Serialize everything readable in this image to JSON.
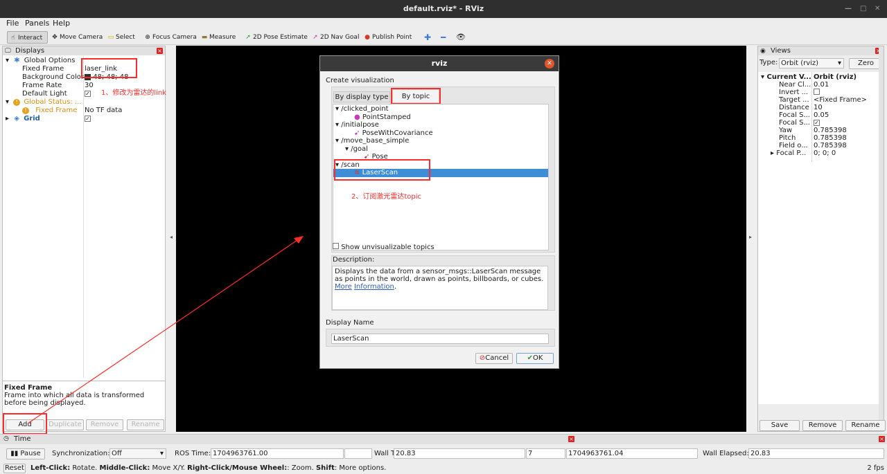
{
  "window": {
    "title": "default.rviz* - RViz"
  },
  "menu": [
    "File",
    "Panels",
    "Help"
  ],
  "toolbar": {
    "interact": "Interact",
    "move_camera": "Move Camera",
    "select": "Select",
    "focus_camera": "Focus Camera",
    "measure": "Measure",
    "pose_estimate": "2D Pose Estimate",
    "nav_goal": "2D Nav Goal",
    "publish_point": "Publish Point"
  },
  "displays": {
    "title": "Displays",
    "global_options": "Global Options",
    "fixed_frame_label": "Fixed Frame",
    "fixed_frame_value": "laser_link",
    "bg_color_label": "Background Color",
    "bg_color_value": "48; 48; 48",
    "frame_rate_label": "Frame Rate",
    "frame_rate_value": "30",
    "default_light_label": "Default Light",
    "global_status": "Global Status: ...",
    "fixed_frame_status": "Fixed Frame",
    "fixed_frame_status_value": "No TF data",
    "grid": "Grid",
    "desc_title": "Fixed Frame",
    "desc_body": "Frame into which all data is transformed before being displayed.",
    "buttons": {
      "add": "Add",
      "duplicate": "Duplicate",
      "remove": "Remove",
      "rename": "Rename"
    }
  },
  "annotations": {
    "step1": "1、修改为雷达的link",
    "step2": "2、订阅激光雷达topic"
  },
  "dialog": {
    "title": "rviz",
    "heading": "Create visualization",
    "tab_display_type": "By display type",
    "tab_topic": "By topic",
    "topics": [
      {
        "name": "/clicked_point",
        "type": "PointStamped"
      },
      {
        "name": "/initialpose",
        "type": "PoseWithCovariance"
      },
      {
        "name": "/move_base_simple",
        "sub": "/goal",
        "type": "Pose"
      },
      {
        "name": "/scan",
        "type": "LaserScan"
      }
    ],
    "show_unvisualizable": "Show unvisualizable topics",
    "description_label": "Description:",
    "description_text": "Displays the data from a sensor_msgs::LaserScan message as points in the world, drawn as points, billboards, or cubes.",
    "more_info_1": "More",
    "more_info_2": "Information",
    "display_name_label": "Display Name",
    "display_name_value": "LaserScan",
    "cancel": "Cancel",
    "ok": "OK"
  },
  "views": {
    "title": "Views",
    "type_label": "Type:",
    "type_value": "Orbit (rviz)",
    "zero": "Zero",
    "current_view": "Current V...",
    "current_view_value": "Orbit (rviz)",
    "props": [
      {
        "k": "Near Cl...",
        "v": "0.01"
      },
      {
        "k": "Invert ...",
        "v": ""
      },
      {
        "k": "Target ...",
        "v": "<Fixed Frame>"
      },
      {
        "k": "Distance",
        "v": "10"
      },
      {
        "k": "Focal S...",
        "v": "0.05"
      },
      {
        "k": "Focal S...",
        "v": ""
      },
      {
        "k": "Yaw",
        "v": "0.785398"
      },
      {
        "k": "Pitch",
        "v": "0.785398"
      },
      {
        "k": "Field o...",
        "v": "0.785398"
      },
      {
        "k": "Focal P...",
        "v": "0; 0; 0"
      }
    ],
    "save": "Save",
    "remove": "Remove",
    "rename": "Rename"
  },
  "time": {
    "title": "Time",
    "pause": "Pause",
    "sync_label": "Synchronization:",
    "sync_value": "Off",
    "ros_time_label": "ROS Time:",
    "ros_time_value": "1704963761.00",
    "wall_time_label": "Wall T",
    "wall_time_value": "20.83",
    "field_7": "7",
    "ros_elapsed": "1704963761.04",
    "wall_elapsed_label": "Wall Elapsed:",
    "wall_elapsed_value": "20.83"
  },
  "status": {
    "reset": "Reset",
    "left_click_b": "Left-Click:",
    "left_click": " Rotate. ",
    "middle_click_b": "Middle-Click:",
    "middle_click": " Move X/Y. ",
    "right_click_b": "Right-Click/Mouse Wheel:",
    "right_click": ": Zoom. ",
    "shift_b": "Shift",
    "shift": ": More options.",
    "fps": "2 fps"
  },
  "colors": {
    "accent": "#3a8ed6",
    "annotation": "#ff2a2a",
    "selected_row": "#3d8ed6"
  }
}
